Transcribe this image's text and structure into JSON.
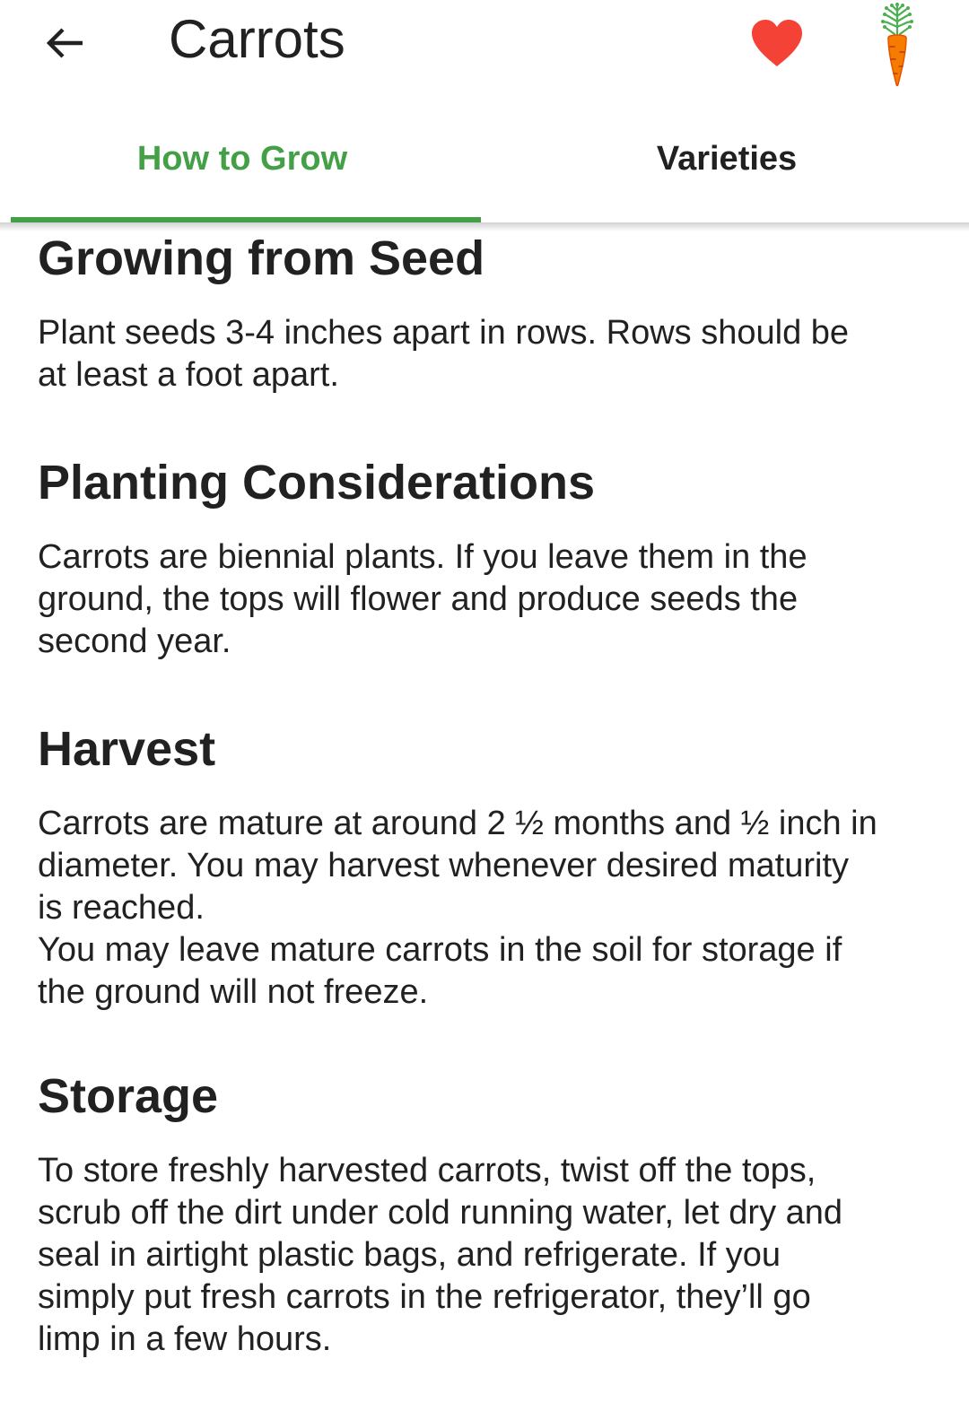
{
  "app_bar": {
    "title": "Carrots",
    "back_icon": "arrow-left-icon",
    "favorite_icon": "heart-icon",
    "favorite_color": "#f44336",
    "image_icon": "carrot-icon"
  },
  "tabs": [
    {
      "label": "How to Grow",
      "active": true
    },
    {
      "label": "Varieties",
      "active": false
    }
  ],
  "colors": {
    "accent": "#43a047",
    "text": "#212121",
    "carrot_orange": "#f57c00",
    "carrot_leaves": "#4caf50"
  },
  "sections": [
    {
      "heading": "Growing from Seed",
      "body": "Plant seeds 3-4 inches apart in rows. Rows should be\nat least a foot apart."
    },
    {
      "heading": "Planting Considerations",
      "body": "Carrots are biennial plants. If you leave them in the\nground, the tops will flower and produce seeds the\nsecond year."
    },
    {
      "heading": "Harvest",
      "body": "Carrots are mature at around 2 ½ months and ½ inch in\ndiameter. You may harvest whenever desired maturity\nis reached.\nYou may leave mature carrots in the soil for storage if\nthe ground will not freeze."
    },
    {
      "heading": "Storage",
      "body": "To store freshly harvested carrots, twist off the tops,\nscrub off the dirt under cold running water, let dry and\nseal in airtight plastic bags, and refrigerate. If you\nsimply put fresh carrots in the refrigerator, they’ll go\nlimp in a few hours."
    }
  ]
}
